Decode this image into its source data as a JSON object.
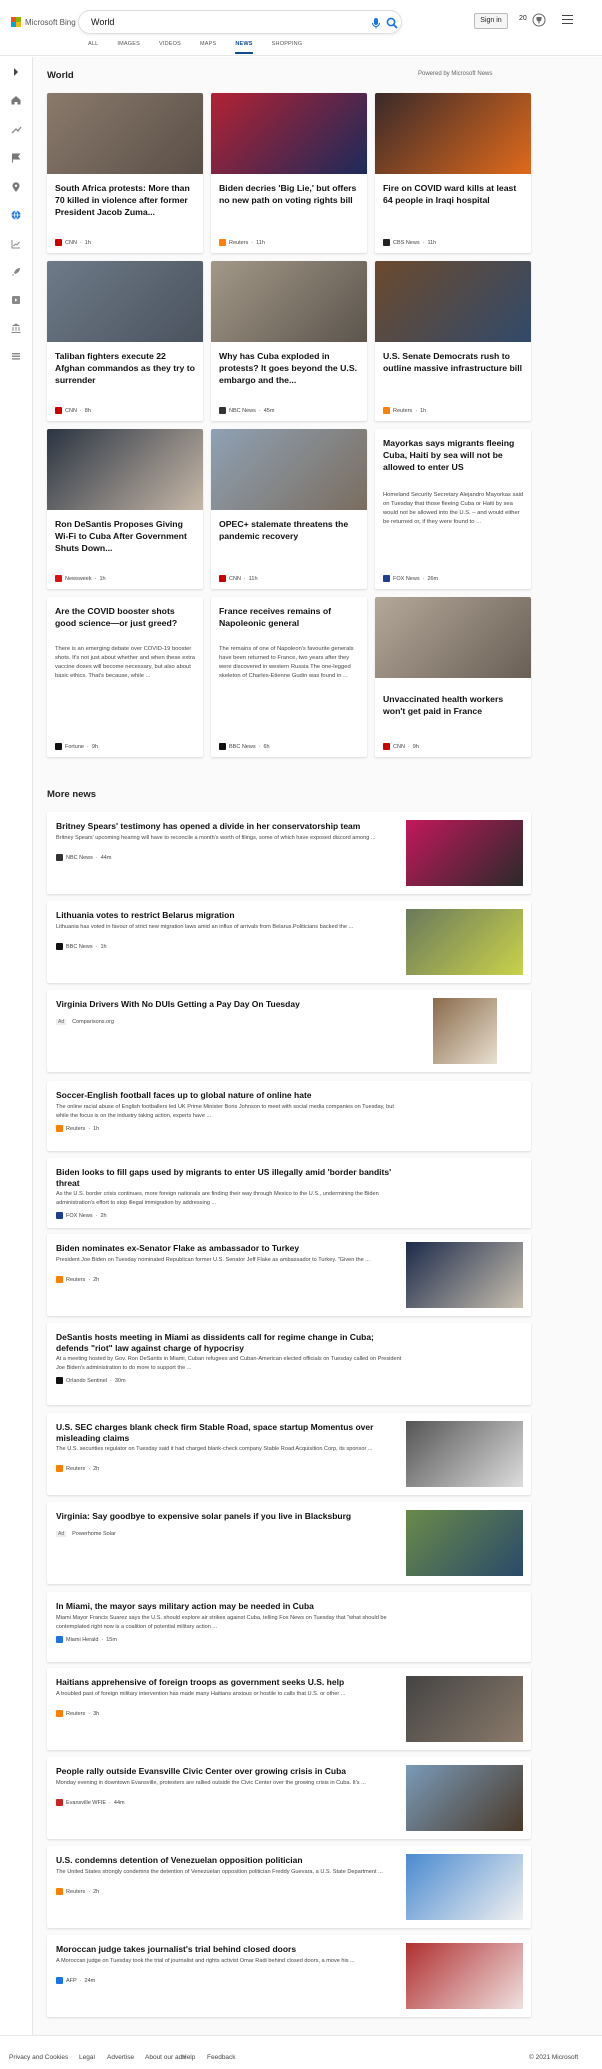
{
  "header": {
    "brand": "Microsoft Bing",
    "query": "World",
    "signin": "Sign in",
    "rewards_count": "20",
    "tabs": [
      "ALL",
      "IMAGES",
      "VIDEOS",
      "MAPS",
      "NEWS",
      "SHOPPING"
    ],
    "active_tab": "NEWS"
  },
  "section": {
    "title": "World",
    "powered": "Powered by Microsoft News"
  },
  "cards": [
    {
      "title": "South Africa protests: More than 70 killed in violence after former President Jacob Zuma...",
      "snippet": "",
      "source": "CNN",
      "time": "1h",
      "src_color": "#cc0000"
    },
    {
      "title": "Biden decries 'Big Lie,' but offers no new path on voting rights bill",
      "snippet": "",
      "source": "Reuters",
      "time": "11h",
      "src_color": "#ff8000"
    },
    {
      "title": "Fire on COVID ward kills at least 64 people in Iraqi hospital",
      "snippet": "",
      "source": "CBS News",
      "time": "11h",
      "src_color": "#222222"
    },
    {
      "title": "Taliban fighters execute 22 Afghan commandos as they try to surrender",
      "snippet": "",
      "source": "CNN",
      "time": "8h",
      "src_color": "#cc0000"
    },
    {
      "title": "Why has Cuba exploded in protests? It goes beyond the U.S. embargo and the...",
      "snippet": "",
      "source": "NBC News",
      "time": "45m",
      "src_color": "#333333"
    },
    {
      "title": "U.S. Senate Democrats rush to outline massive infrastructure bill",
      "snippet": "",
      "source": "Reuters",
      "time": "1h",
      "src_color": "#ff8000"
    },
    {
      "title": "Ron DeSantis Proposes Giving Wi-Fi to Cuba After Government Shuts Down...",
      "snippet": "",
      "source": "Newsweek",
      "time": "1h",
      "src_color": "#dd1111"
    },
    {
      "title": "OPEC+ stalemate threatens the pandemic recovery",
      "snippet": "",
      "source": "CNN",
      "time": "11h",
      "src_color": "#cc0000"
    },
    {
      "title": "Mayorkas says migrants fleeing Cuba, Haiti by sea will not be allowed to enter US",
      "snippet": "Homeland Security Secretary Alejandro Mayorkas said on Tuesday that those fleeing Cuba or Haiti by sea would not be allowed into the U.S. – and would either be returned or, if they were found to ...",
      "source": "FOX News",
      "time": "26m",
      "src_color": "#1c3f94"
    },
    {
      "title": "Are the COVID booster shots good science—or just greed?",
      "snippet": "There is an emerging debate over COVID-19 booster shots. It's not just about whether and when these extra vaccine doses will become necessary, but also about basic ethics. That's because, while ...",
      "source": "Fortune",
      "time": "9h",
      "src_color": "#111111"
    },
    {
      "title": "France receives remains of Napoleonic general",
      "snippet": "The remains of one of Napoleon's favourite generals have been returned to France, two years after they were discovered in western Russia The one-legged skeleton of Charles-Etienne Gudin was found in ...",
      "source": "BBC News",
      "time": "6h",
      "src_color": "#111111"
    },
    {
      "title": "Unvaccinated health workers won't get paid in France",
      "snippet": "",
      "source": "CNN",
      "time": "9h",
      "src_color": "#cc0000"
    }
  ],
  "more_news": {
    "title": "More news",
    "items": [
      {
        "title": "Britney Spears' testimony has opened a divide in her conservatorship team",
        "snippet": "Britney Spears' upcoming hearing will have to reconcile a month's worth of filings, some of which have exposed discord among ...",
        "source": "NBC News",
        "time": "44m",
        "ad": false,
        "src_color": "#333333"
      },
      {
        "title": "Lithuania votes to restrict Belarus migration",
        "snippet": "Lithuania has voted in favour of strict new migration laws amid an influx of arrivals from Belarus.Politicians backed the ...",
        "source": "BBC News",
        "time": "1h",
        "ad": false,
        "src_color": "#111111"
      },
      {
        "title": "Virginia Drivers With No DUIs Getting a Pay Day On Tuesday",
        "snippet": "",
        "source": "Comparisons.org",
        "time": "",
        "ad": true,
        "ad_label": "Ad",
        "src_color": ""
      },
      {
        "title": "Soccer-English football faces up to global nature of online hate",
        "snippet": "The online racial abuse of English footballers led UK Prime Minister Boris Johnson to meet with social media companies on Tuesday, but while the focus is on the industry taking action, experts have ...",
        "source": "Reuters",
        "time": "1h",
        "ad": false,
        "src_color": "#ff8000"
      },
      {
        "title": "Biden looks to fill gaps used by migrants to enter US illegally amid 'border bandits' threat",
        "snippet": "As the U.S. border crisis continues, more foreign nationals are finding their way through Mexico to the U.S., undermining the Biden administration's effort to stop illegal immigration by addressing ...",
        "source": "FOX News",
        "time": "2h",
        "ad": false,
        "src_color": "#1c3f94"
      },
      {
        "title": "Biden nominates ex-Senator Flake as ambassador to Turkey",
        "snippet": "President Joe Biden on Tuesday nominated Republican former U.S. Senator Jeff Flake as ambassador to Turkey. \"Given the ...",
        "source": "Reuters",
        "time": "2h",
        "ad": false,
        "src_color": "#ff8000"
      },
      {
        "title": "DeSantis hosts meeting in Miami as dissidents call for regime change in Cuba; defends \"riot\" law against charge of hypocrisy",
        "snippet": "At a meeting hosted by Gov. Ron DeSantis in Miami, Cuban refugees and Cuban-American elected officials on Tuesday called on President Joe Biden's administration to do more to support the ...",
        "source": "Orlando Sentinel",
        "time": "30m",
        "ad": false,
        "src_color": "#111111"
      },
      {
        "title": "U.S. SEC charges blank check firm Stable Road, space startup Momentus over misleading claims",
        "snippet": "The U.S. securities regulator on Tuesday said it had charged blank-check company Stable Road Acquisition Corp, its sponsor ...",
        "source": "Reuters",
        "time": "2h",
        "ad": false,
        "src_color": "#ff8000"
      },
      {
        "title": "Virginia: Say goodbye to expensive solar panels if you live in Blacksburg",
        "snippet": "",
        "source": "Powerhome Solar",
        "time": "",
        "ad": true,
        "ad_label": "Ad",
        "src_color": ""
      },
      {
        "title": "In Miami, the mayor says military action may be needed in Cuba",
        "snippet": "Miami Mayor Francis Suarez says the U.S. should explore air strikes against Cuba, telling Fox News on Tuesday that \"what should be contemplated right now is a coalition of potential military action ...",
        "source": "Miami Herald",
        "time": "15m",
        "ad": false,
        "src_color": "#1a73e8"
      },
      {
        "title": "Haitians apprehensive of foreign troops as government seeks U.S. help",
        "snippet": "A troubled past of foreign military intervention has made many Haitians anxious or hostile to calls that U.S. or other ...",
        "source": "Reuters",
        "time": "3h",
        "ad": false,
        "src_color": "#ff8000"
      },
      {
        "title": "People rally outside Evansville Civic Center over growing crisis in Cuba",
        "snippet": "Monday evening in downtown Evansville, protesters are rallied outside the Civic Center over the growing crisis in Cuba. It's ...",
        "source": "Evansville WFIE",
        "time": "44m",
        "ad": false,
        "src_color": "#cc2222"
      },
      {
        "title": "U.S. condemns detention of Venezuelan opposition politician",
        "snippet": "The United States strongly condemns the detention of Venezuelan opposition politician Freddy Guevara, a U.S. State Department ...",
        "source": "Reuters",
        "time": "2h",
        "ad": false,
        "src_color": "#ff8000"
      },
      {
        "title": "Moroccan judge takes journalist's trial behind closed doors",
        "snippet": "A Moroccan judge on Tuesday took the trial of journalist and rights activist Omar Radi behind closed doors, a move his ...",
        "source": "AFP",
        "time": "24m",
        "ad": false,
        "src_color": "#1a73e8"
      }
    ]
  },
  "footer": {
    "links": [
      "Privacy and Cookies",
      "Legal",
      "Advertise",
      "About our ads",
      "Help",
      "Feedback"
    ],
    "copyright": "© 2021 Microsoft"
  }
}
